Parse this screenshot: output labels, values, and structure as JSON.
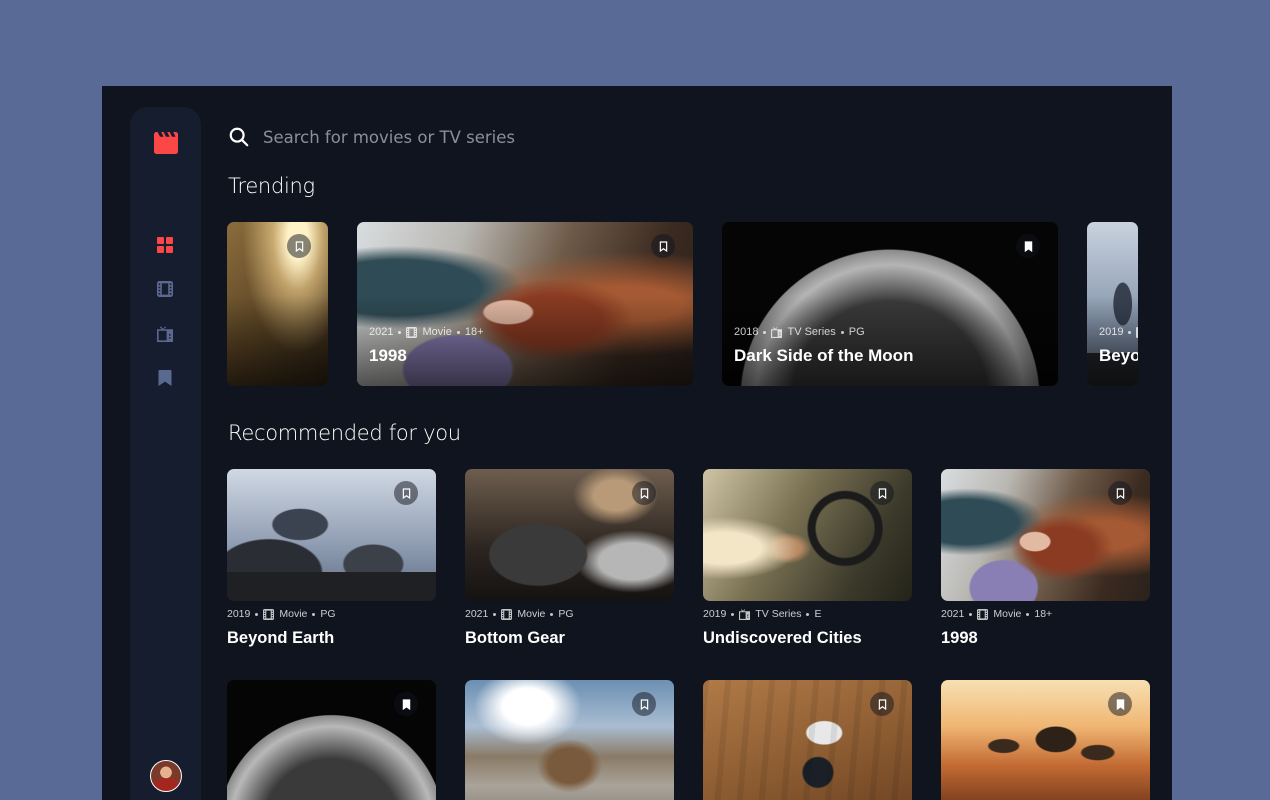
{
  "colors": {
    "accent": "#fc4747",
    "nav_inactive": "#5a698f",
    "surface": "#161d2f",
    "background": "#10141e"
  },
  "sidebar": {
    "logo_icon": "clapperboard-icon",
    "nav": [
      {
        "id": "home",
        "icon": "grid-icon",
        "active": true
      },
      {
        "id": "movies",
        "icon": "film-icon",
        "active": false
      },
      {
        "id": "tv",
        "icon": "tv-icon",
        "active": false
      },
      {
        "id": "bookmarks",
        "icon": "bookmark-icon",
        "active": false
      }
    ]
  },
  "search": {
    "placeholder": "Search for movies or TV series"
  },
  "trending": {
    "title": "Trending",
    "items": [
      {
        "year": "",
        "category": "",
        "rating": "",
        "title": "",
        "bookmarked": false
      },
      {
        "year": "2021",
        "category": "Movie",
        "rating": "18+",
        "title": "1998",
        "bookmarked": false
      },
      {
        "year": "2018",
        "category": "TV Series",
        "rating": "PG",
        "title": "Dark Side of the Moon",
        "bookmarked": true
      },
      {
        "year": "2019",
        "category": "",
        "rating": "",
        "title": "Beyo",
        "bookmarked": false
      }
    ]
  },
  "recommended": {
    "title": "Recommended for you",
    "items": [
      {
        "year": "2019",
        "category": "Movie",
        "rating": "PG",
        "title": "Beyond Earth",
        "bookmarked": false
      },
      {
        "year": "2021",
        "category": "Movie",
        "rating": "PG",
        "title": "Bottom Gear",
        "bookmarked": false
      },
      {
        "year": "2019",
        "category": "TV Series",
        "rating": "E",
        "title": "Undiscovered Cities",
        "bookmarked": false
      },
      {
        "year": "2021",
        "category": "Movie",
        "rating": "18+",
        "title": "1998",
        "bookmarked": false
      },
      {
        "bookmarked": true
      },
      {
        "bookmarked": false
      },
      {
        "bookmarked": false
      },
      {
        "bookmarked": true
      }
    ]
  }
}
